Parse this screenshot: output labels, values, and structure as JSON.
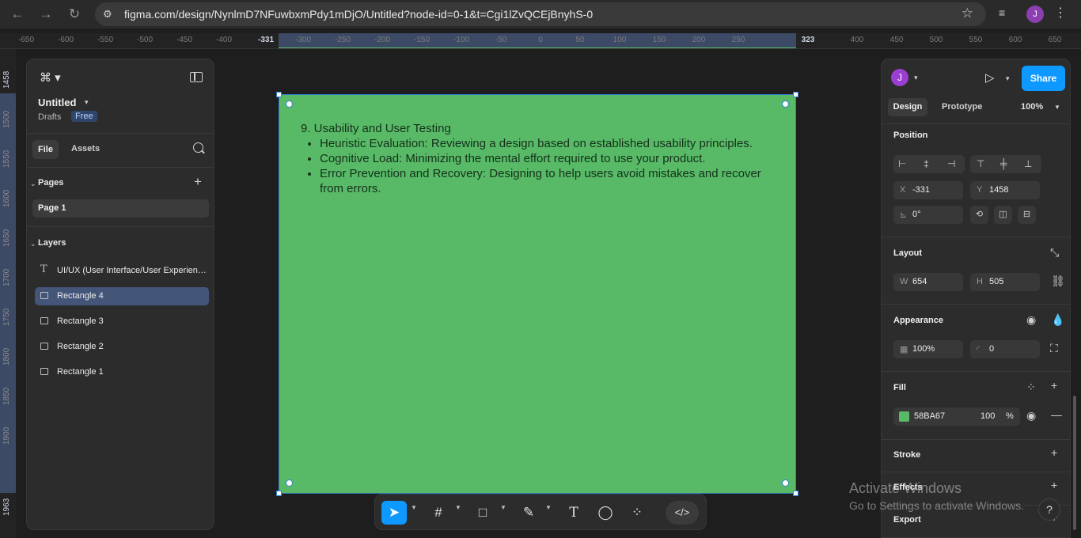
{
  "browser": {
    "url": "figma.com/design/NynlmD7NFuwbxmPdy1mDjO/Untitled?node-id=0-1&t=Cgi1lZvQCEjBnyhS-0",
    "profile_initial": "J"
  },
  "rulers": {
    "top_ticks": [
      "-650",
      "-600",
      "-550",
      "-500",
      "-450",
      "-400",
      "-331",
      "-300",
      "-250",
      "-200",
      "-150",
      "-100",
      "-50",
      "0",
      "50",
      "100",
      "150",
      "200",
      "250",
      "323",
      "400",
      "450",
      "500",
      "550",
      "600",
      "650"
    ],
    "left_ticks": [
      "1458",
      "1500",
      "1550",
      "1600",
      "1650",
      "1700",
      "1750",
      "1800",
      "1850",
      "1900",
      "1963"
    ]
  },
  "left_panel": {
    "file_name": "Untitled",
    "location": "Drafts",
    "plan_badge": "Free",
    "tabs": {
      "file": "File",
      "assets": "Assets"
    },
    "pages_label": "Pages",
    "pages": [
      "Page 1"
    ],
    "layers_label": "Layers",
    "layers": [
      {
        "name": "UI/UX (User Interface/User Experience)",
        "type": "text",
        "selected": false
      },
      {
        "name": "Rectangle 4",
        "type": "rect",
        "selected": true
      },
      {
        "name": "Rectangle 3",
        "type": "rect",
        "selected": false
      },
      {
        "name": "Rectangle 2",
        "type": "rect",
        "selected": false
      },
      {
        "name": "Rectangle 1",
        "type": "rect",
        "selected": false
      }
    ]
  },
  "canvas": {
    "fill_color": "#58BA67",
    "heading": "9. Usability and User Testing",
    "bullets": [
      "Heuristic Evaluation: Reviewing a design based on established usability principles.",
      "Cognitive Load: Minimizing the mental effort required to use your product.",
      "Error Prevention and Recovery: Designing to help users avoid mistakes and recover from errors."
    ]
  },
  "right_panel": {
    "user_initial": "J",
    "share_label": "Share",
    "tabs": {
      "design": "Design",
      "prototype": "Prototype"
    },
    "zoom": "100%",
    "position": {
      "label": "Position",
      "x_label": "X",
      "x": "-331",
      "y_label": "Y",
      "y": "1458",
      "rotation": "0°"
    },
    "layout": {
      "label": "Layout",
      "w_label": "W",
      "w": "654",
      "h_label": "H",
      "h": "505"
    },
    "appearance": {
      "label": "Appearance",
      "opacity": "100%",
      "radius": "0"
    },
    "fill": {
      "label": "Fill",
      "hex": "58BA67",
      "opacity": "100",
      "unit": "%"
    },
    "stroke_label": "Stroke",
    "effects_label": "Effects",
    "export_label": "Export"
  },
  "watermark": {
    "line1": "Activate Windows",
    "line2": "Go to Settings to activate Windows."
  },
  "help_label": "?"
}
